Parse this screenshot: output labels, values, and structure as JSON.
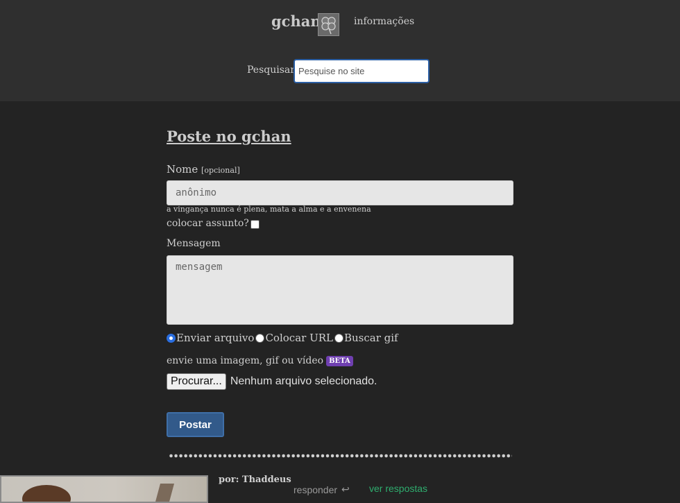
{
  "header": {
    "logo_text": "gchan",
    "info_link": "informações",
    "search_label": "Pesquisar",
    "search_placeholder": "Pesquise no site"
  },
  "form": {
    "title": "Poste no gchan",
    "name_label": "Nome",
    "name_optional": "[opcional]",
    "name_placeholder": "anônimo",
    "tagline": "a vingança nunca é plena, mata a alma e a envenena",
    "subject_label": "colocar assunto?",
    "subject_checked": false,
    "message_label": "Mensagem",
    "message_placeholder": "mensagem",
    "upload_options": [
      {
        "label": "Enviar arquivo",
        "checked": true
      },
      {
        "label": "Colocar URL",
        "checked": false
      },
      {
        "label": "Buscar gif",
        "checked": false
      }
    ],
    "upload_hint": "envie uma imagem, gif ou vídeo",
    "beta_badge": "BETA",
    "file_button": "Procurar...",
    "file_status": "Nenhum arquivo selecionado.",
    "submit": "Postar"
  },
  "post": {
    "author": "por: Thaddeus",
    "reply": "responder",
    "see_replies": "ver respostas"
  },
  "colors": {
    "background": "#232323",
    "header_bg": "#2f2f2f",
    "accent_blue": "#325a8a",
    "beta_purple": "#6f3fb0",
    "link_green": "#2fae6f"
  }
}
